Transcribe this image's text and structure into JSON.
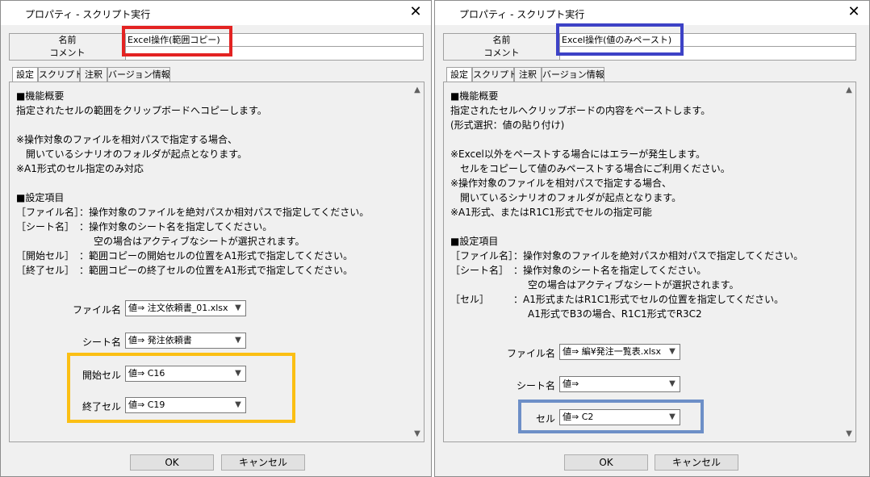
{
  "colors": {
    "highlight_red": "#e32322",
    "highlight_yellow": "#fbbf14",
    "highlight_navy": "#3d42c6",
    "highlight_lightblue": "#6d8fc7"
  },
  "left": {
    "title": "プロパティ - スクリプト実行",
    "close_icon": "✕",
    "props": {
      "name_label": "名前",
      "name_value": "Excel操作(範囲コピー)",
      "comment_label": "コメント",
      "comment_value": ""
    },
    "tabs": [
      "設定",
      "スクリプト",
      "注釈",
      "バージョン情報"
    ],
    "description": [
      "■機能概要",
      "指定されたセルの範囲をクリップボードへコピーします。",
      "",
      "※操作対象のファイルを相対パスで指定する場合、",
      "　開いているシナリオのフォルダが起点となります。",
      "※A1形式のセル指定のみ対応",
      "",
      "■設定項目",
      "［ファイル名］：操作対象のファイルを絶対パスか相対パスで指定してください。",
      "［シート名］　：操作対象のシート名を指定してください。",
      "　　　　　　　　空の場合はアクティブなシートが選択されます。",
      "［開始セル］　：範囲コピーの開始セルの位置をA1形式で指定してください。",
      "［終了セル］　：範囲コピーの終了セルの位置をA1形式で指定してください。"
    ],
    "fields": [
      {
        "label": "ファイル名",
        "value": "値⇒ 注文依頼書_01.xlsx"
      },
      {
        "label": "シート名",
        "value": "値⇒ 発注依頼書"
      },
      {
        "label": "開始セル",
        "value": "値⇒ C16"
      },
      {
        "label": "終了セル",
        "value": "値⇒ C19"
      }
    ],
    "ok": "OK",
    "cancel": "キャンセル"
  },
  "right": {
    "title": "プロパティ - スクリプト実行",
    "close_icon": "✕",
    "props": {
      "name_label": "名前",
      "name_value": "Excel操作(値のみペースト)",
      "comment_label": "コメント",
      "comment_value": ""
    },
    "tabs": [
      "設定",
      "スクリプト",
      "注釈",
      "バージョン情報"
    ],
    "description": [
      "■機能概要",
      "指定されたセルへクリップボードの内容をペーストします。",
      "(形式選択：値の貼り付け)",
      "",
      "※Excel以外をペーストする場合にはエラーが発生します。",
      "　セルをコピーして値のみペーストする場合にご利用ください。",
      "※操作対象のファイルを相対パスで指定する場合、",
      "　開いているシナリオのフォルダが起点となります。",
      "※A1形式、またはR1C1形式でセルの指定可能",
      "",
      "■設定項目",
      "［ファイル名］：操作対象のファイルを絶対パスか相対パスで指定してください。",
      "［シート名］　：操作対象のシート名を指定してください。",
      "　　　　　　　　空の場合はアクティブなシートが選択されます。",
      "［セル］　　　：A1形式またはR1C1形式でセルの位置を指定してください。",
      "　　　　　　　　A1形式でB3の場合、R1C1形式でR3C2"
    ],
    "fields": [
      {
        "label": "ファイル名",
        "value": "値⇒ 編¥発注一覧表.xlsx"
      },
      {
        "label": "シート名",
        "value": "値⇒"
      },
      {
        "label": "セル",
        "value": "値⇒ C2"
      }
    ],
    "ok": "OK",
    "cancel": "キャンセル"
  }
}
